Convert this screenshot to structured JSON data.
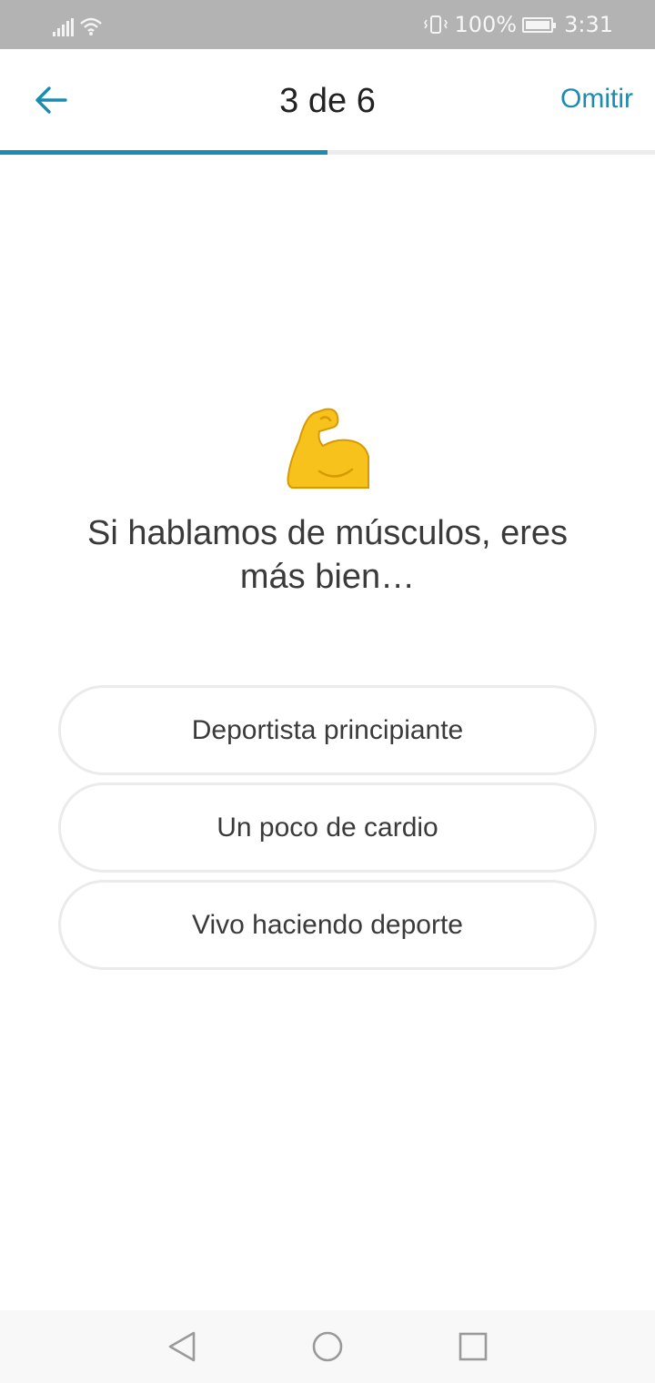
{
  "status_bar": {
    "battery_text": "100%",
    "time": "3:31",
    "icons": [
      "signal-icon",
      "wifi-icon",
      "vibrate-icon",
      "battery-charging-icon"
    ]
  },
  "header": {
    "step_text": "3 de 6",
    "skip_label": "Omitir",
    "back_icon": "arrow-left-icon",
    "progress_fraction": 0.5
  },
  "main": {
    "emoji_icon": "flexed-biceps-icon",
    "question": "Si hablamos de músculos, eres más bien…",
    "options": [
      {
        "label": "Deportista principiante"
      },
      {
        "label": "Un poco de cardio"
      },
      {
        "label": "Vivo haciendo deporte"
      }
    ]
  },
  "nav_bar": {
    "icons": [
      "back-triangle-icon",
      "home-circle-icon",
      "recents-square-icon"
    ]
  },
  "colors": {
    "accent": "#1a8bb1",
    "status_bar": "#b3b3b3",
    "emoji_yellow": "#f7c21b"
  }
}
